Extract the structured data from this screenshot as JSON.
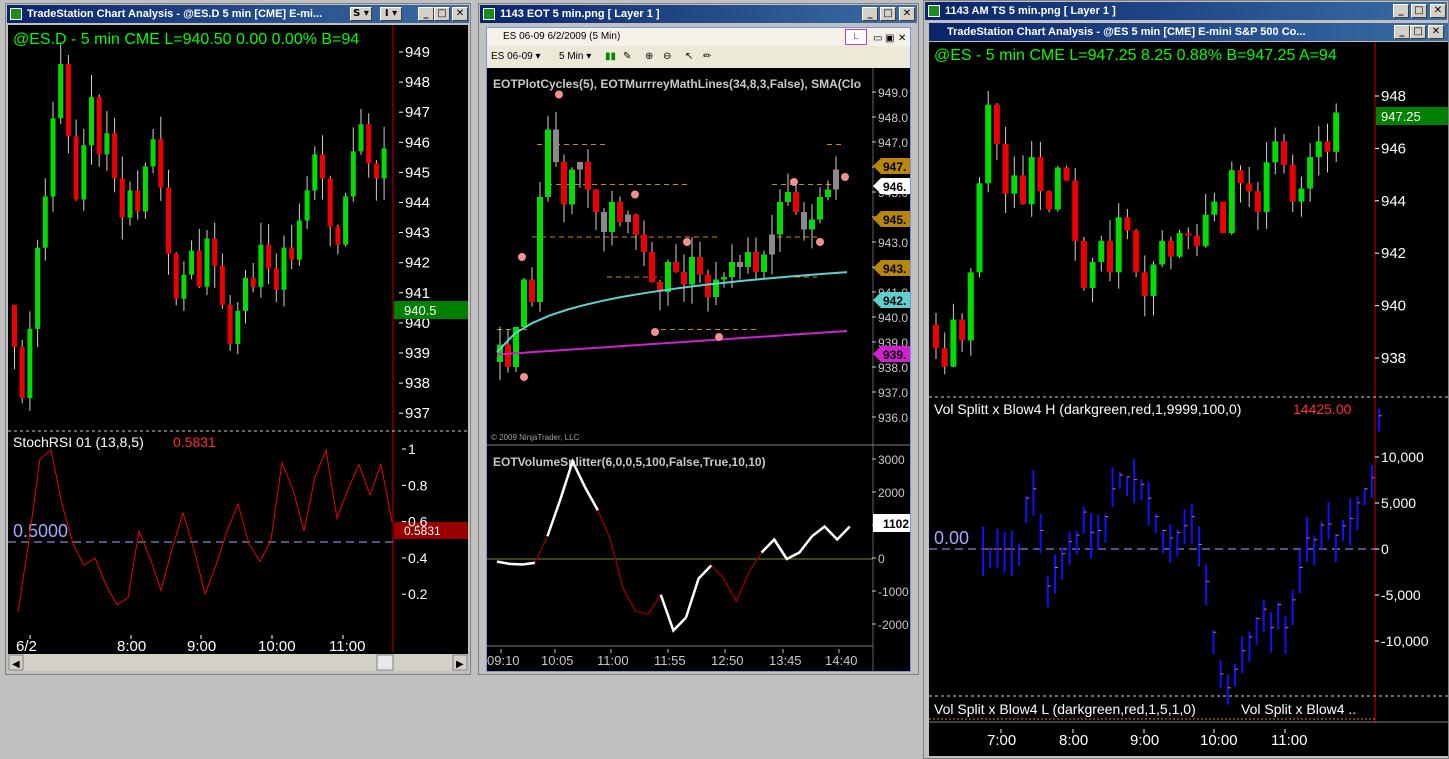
{
  "win1": {
    "title": "TradeStation Chart Analysis - @ES.D 5 min [CME] E-mi...",
    "btn_s": "S",
    "btn_i": "I",
    "header": "@ES.D - 5 min  CME  L=940.50  0.00  0.00%  B=94",
    "price_ticks": [
      "949",
      "948",
      "947",
      "946",
      "945",
      "944",
      "943",
      "942",
      "941",
      "940",
      "939",
      "938",
      "937"
    ],
    "last_marker": "940.5",
    "ind_label": "StochRSI 01 (13,8,5)",
    "ind_value": "0.5831",
    "ind_ref": "0.5000",
    "ind_marker": "0.5831",
    "ind_ticks": [
      "1",
      "0.8",
      "0.6",
      "0.4",
      "0.2"
    ],
    "time_labels": [
      "6/2",
      "8:00",
      "9:00",
      "10:00",
      "11:00"
    ]
  },
  "win2": {
    "title": "1143 EOT 5 min.png [ Layer 1 ]",
    "inner_title": "ES 06-09  6/2/2009 (5 Min)",
    "instrument": "ES 06-09",
    "interval": "5 Min",
    "tab_label": "L",
    "indicators": "EOTPlotCycles(5), EOTMurrreyMathLines(34,8,3,False), SMA(Clo",
    "price_ticks": [
      "949.0",
      "948.0",
      "947.0",
      "946.0",
      "945.0",
      "944.0",
      "943.0",
      "942.0",
      "941.0",
      "940.0",
      "939.0",
      "938.0",
      "937.0",
      "936.0"
    ],
    "level_tags": [
      "947.",
      "946.",
      "945.",
      "943.",
      "942.",
      "939."
    ],
    "copyright": "© 2009 NinjaTrader, LLC",
    "ind_label": "EOTVolumeSplitter(6,0,0,5,100,False,True,10,10)",
    "ind_ticks": [
      "3000",
      "2000",
      "1000",
      "0",
      "-1000",
      "-2000"
    ],
    "ind_marker": "1102",
    "time_labels": [
      "09:10",
      "10:05",
      "11:00",
      "11:55",
      "12:50",
      "13:45",
      "14:40"
    ]
  },
  "win3": {
    "title": "1143 AM TS 5 min.png [ Layer 1 ]",
    "inner_title": "TradeStation Chart Analysis - @ES 5 min [CME] E-mini S&P 500 Co...",
    "header": "@ES - 5 min  CME  L=947.25  8.25  0.88%  B=947.25  A=94",
    "price_ticks": [
      "948",
      "946",
      "944",
      "942",
      "940",
      "938"
    ],
    "last_marker": "947.25",
    "ind_label": "Vol Splitt x Blow4 H (darkgreen,red,1,9999,100,0)",
    "ind_value": "14425.00",
    "ind_ref": "0.00",
    "ind_ticks": [
      "10,000",
      "5,000",
      "0",
      "-5,000",
      "-10,000"
    ],
    "ind2_label": "Vol Split x Blow4 L (darkgreen,red,1,5,1,0)",
    "ind2_label_b": "Vol Split x Blow4 ..",
    "time_labels": [
      "7:00",
      "8:00",
      "9:00",
      "10:00",
      "11:00"
    ]
  },
  "colors": {
    "up_bar": "#00dd00",
    "down_bar": "#ee0000",
    "gray_bar": "#8a8a8a",
    "header_green": "#00ff00",
    "stoch_line": "#dd0000",
    "volume_blue": "#1010ff",
    "sma_cyan": "#5fd0d0",
    "sma_magenta": "#d020d0",
    "murrey_orange": "#d08a00",
    "cycle_pink": "#f09090",
    "level_gold": "#b8860b"
  }
}
